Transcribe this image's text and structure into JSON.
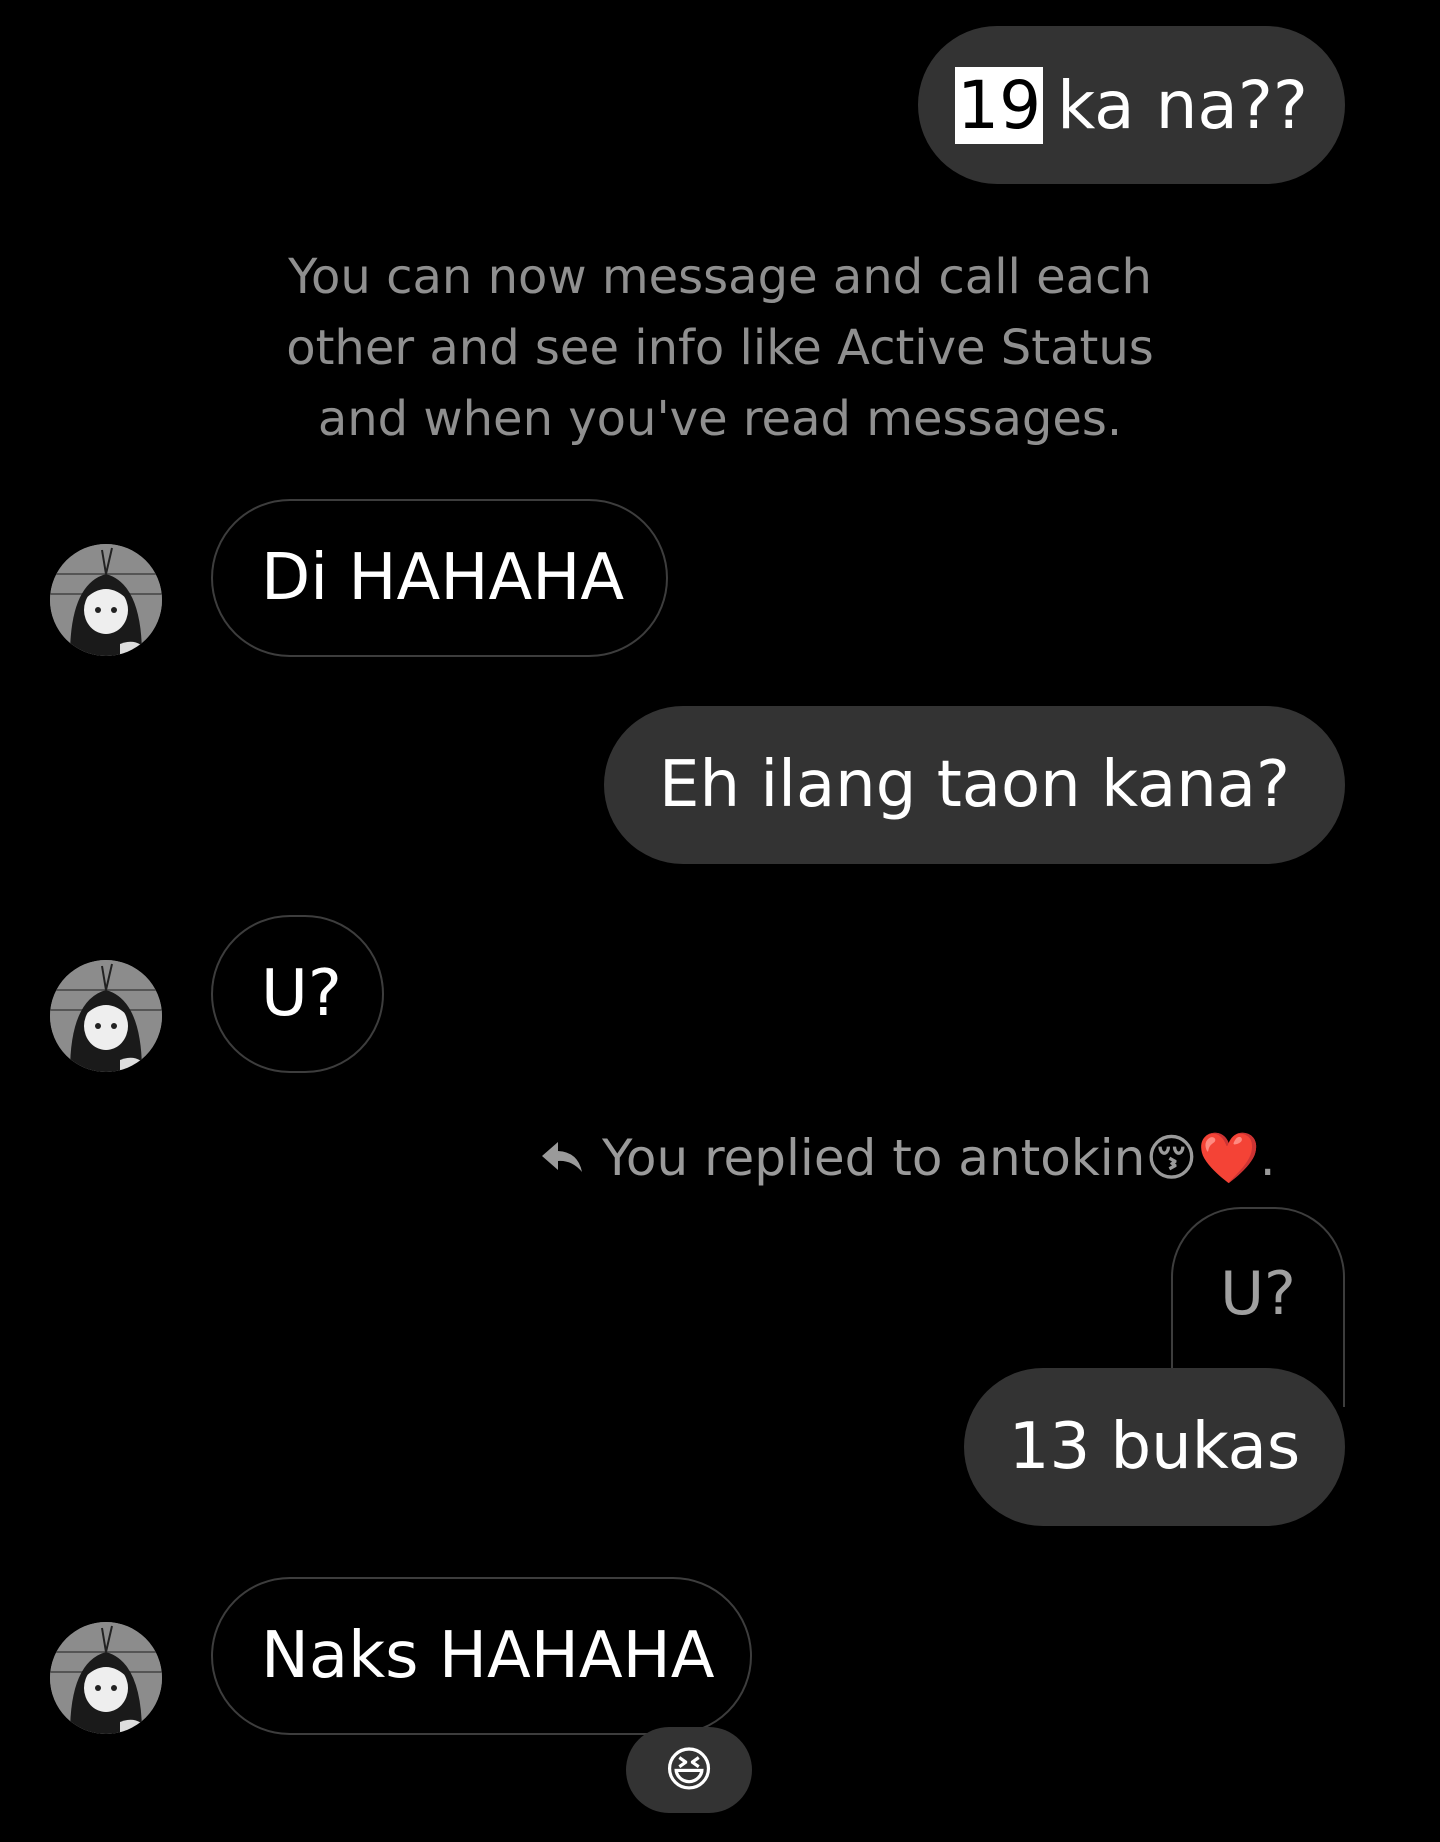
{
  "messages": {
    "m1": {
      "number": "19",
      "text": "ka na??"
    },
    "system_note": "You can now message and call each other and see info like Active Status and when you've read messages.",
    "m2": {
      "text": "Di  HAHAHA"
    },
    "m3": {
      "text": "Eh ilang taon kana?"
    },
    "m4": {
      "text": "U?"
    },
    "reply": {
      "header": "You replied to antokin😚❤️.",
      "quoted_text": "U?",
      "text": "13 bukas"
    },
    "m5": {
      "text": "Naks HAHAHA",
      "reaction": "😆"
    }
  },
  "colors": {
    "background": "#000000",
    "sent_bubble": "#333333",
    "received_border": "#3d3d3d",
    "muted_text": "#8f8f8f"
  },
  "icons": {
    "avatar": "anime-girl-avatar",
    "reply": "reply-arrow-icon"
  }
}
